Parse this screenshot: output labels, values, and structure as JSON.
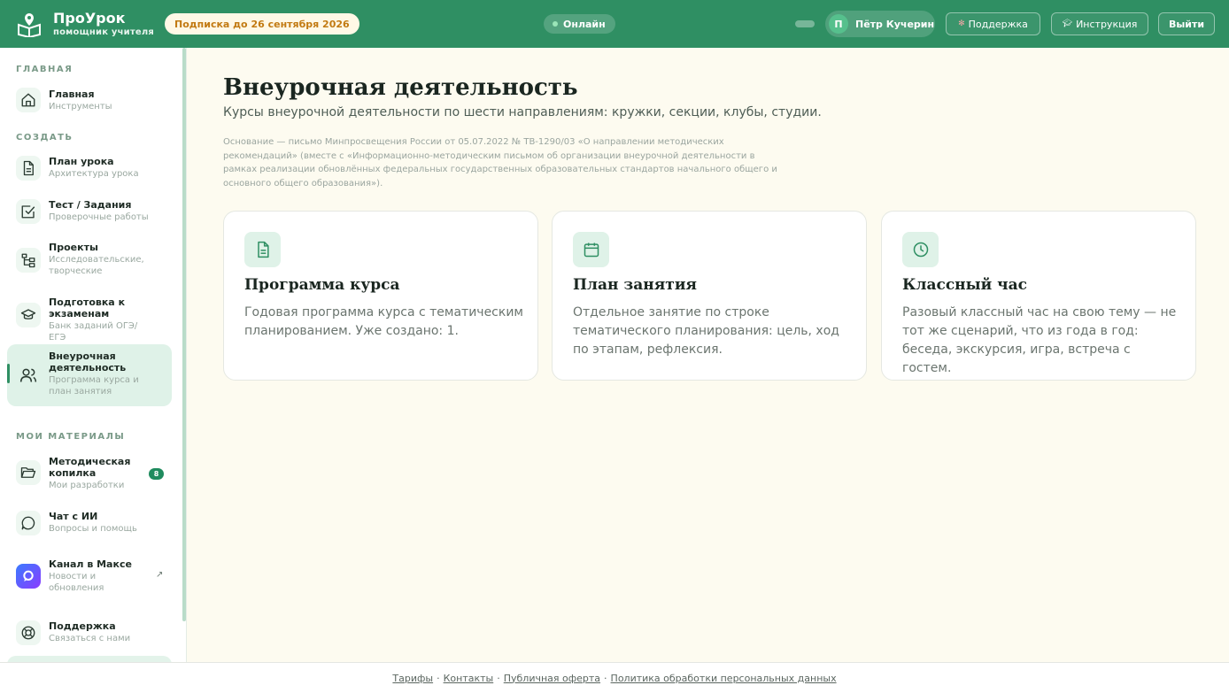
{
  "header": {
    "logo_title": "ПроУрок",
    "logo_subtitle": "помощник учителя",
    "subscription": "Подписка до 26 сентября 2026",
    "status": "Онлайн",
    "user_initial": "П",
    "user_name": "Пётр Кучерин",
    "support_label": "Поддержка",
    "guide_label": "Инструкция",
    "logout_label": "Выйти"
  },
  "sidebar": {
    "section_main": "ГЛАВНАЯ",
    "section_create": "СОЗДАТЬ",
    "section_materials": "МОИ МАТЕРИАЛЫ",
    "items": [
      {
        "title": "Главная",
        "sub": "Инструменты",
        "icon": "home-icon"
      },
      {
        "title": "План урока",
        "sub": "Архитектура урока",
        "icon": "document-icon"
      },
      {
        "title": "Тест / Задания",
        "sub": "Проверочные работы",
        "icon": "checkbox-icon"
      },
      {
        "title": "Проекты",
        "sub": "Исследовательские, творческие",
        "icon": "tree-icon"
      },
      {
        "title": "Подготовка к экзаменам",
        "sub": "Банк заданий ОГЭ/ЕГЭ",
        "icon": "graduation-cap-icon"
      },
      {
        "title": "Внеурочная деятельность",
        "sub": "Программа курса и план занятия",
        "icon": "users-icon"
      },
      {
        "title": "Методическая копилка",
        "sub": "Мои разработки",
        "icon": "folder-icon",
        "badge": "8"
      },
      {
        "title": "Чат с ИИ",
        "sub": "Вопросы и помощь",
        "icon": "chat-icon"
      },
      {
        "title": "Канал в Максе",
        "sub": "Новости и обновления",
        "icon": "max-logo-icon",
        "ext": "↗"
      },
      {
        "title": "Поддержка",
        "sub": "Связаться с нами",
        "icon": "lifebuoy-icon"
      }
    ]
  },
  "main": {
    "title": "Внеурочная деятельность",
    "subtitle": "Курсы внеурочной деятельности по шести направлениям: кружки, секции, клубы, студии.",
    "basis": "Основание — письмо Минпросвещения России от 05.07.2022 № ТВ-1290/03 «О направлении методических рекомендаций» (вместе с «Информационно-методическим письмом об организации внеурочной деятельности в рамках реализации обновлённых федеральных государственных образовательных стандартов начального общего и основного общего образования»).",
    "cards": [
      {
        "title": "Программа курса",
        "desc": "Годовая программа курса с тематическим планированием. Уже создано: 1.",
        "icon": "document-icon"
      },
      {
        "title": "План занятия",
        "desc": "Отдельное занятие по строке тематического планирования: цель, ход по этапам, рефлексия.",
        "icon": "calendar-icon"
      },
      {
        "title": "Классный час",
        "desc": "Разовый классный час на свою тему — не тот же сценарий, что из года в год: беседа, экскурсия, игра, встреча с гостем.",
        "icon": "clock-icon"
      }
    ]
  },
  "footer": {
    "links": [
      "Тарифы",
      "Контакты",
      "Публичная оферта",
      "Политика обработки персональных данных"
    ],
    "separator": "·"
  },
  "colors": {
    "accent": "#2f8f63",
    "background": "#fdfbf0",
    "subscription_text": "#c27a12"
  }
}
